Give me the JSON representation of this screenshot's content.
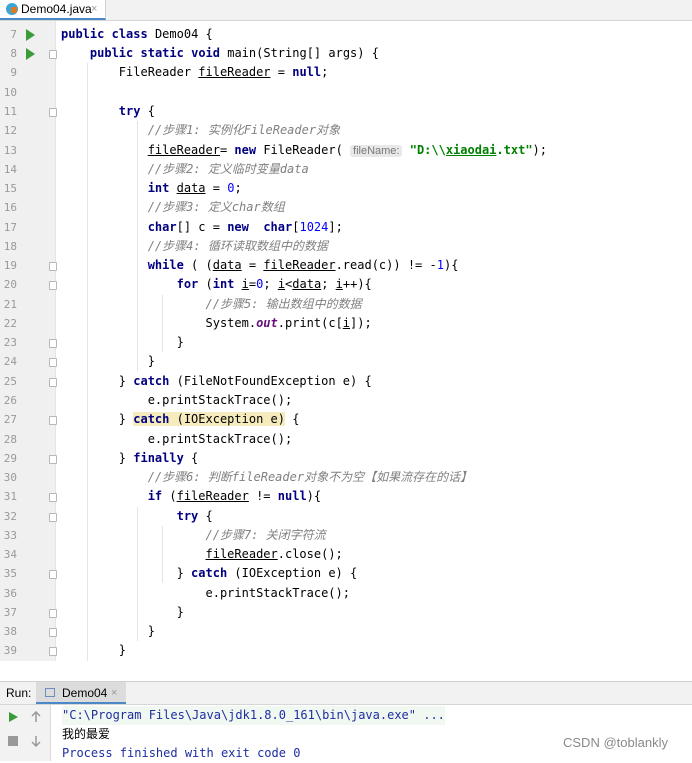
{
  "tab": {
    "file_name": "Demo04.java",
    "close": "×",
    "icon": "java-class-icon"
  },
  "editor": {
    "line_numbers": [
      "7",
      "8",
      "9",
      "10",
      "11",
      "12",
      "13",
      "14",
      "15",
      "16",
      "17",
      "18",
      "19",
      "20",
      "21",
      "22",
      "23",
      "24",
      "25",
      "26",
      "27",
      "28",
      "29",
      "30",
      "31",
      "32",
      "33",
      "34",
      "35",
      "36",
      "37",
      "38",
      "39"
    ],
    "param_hint": "fileName:"
  },
  "run_panel": {
    "label": "Run:",
    "tab_name": "Demo04",
    "tab_close": "×",
    "output": [
      "\"C:\\Program Files\\Java\\jdk1.8.0_161\\bin\\java.exe\" ...",
      "我的最爱",
      "Process finished with exit code 0"
    ]
  },
  "watermark": "CSDN @toblankly",
  "colors": {
    "keyword": "#000080",
    "comment": "#808080",
    "string": "#008000",
    "number": "#0000ff",
    "field": "#660e7a",
    "run_green": "#3a9b3a"
  }
}
